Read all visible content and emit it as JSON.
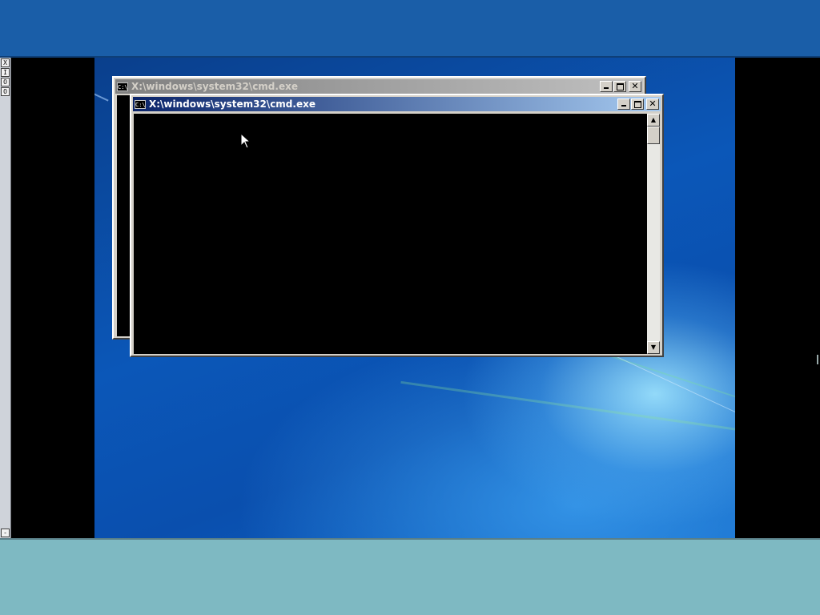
{
  "viewer_toolbar": {
    "buttons": [
      "X",
      "I",
      "O",
      "O"
    ],
    "bottom_button": "-"
  },
  "windows": [
    {
      "title": "X:\\windows\\system32\\cmd.exe",
      "state": "inactive",
      "icon": "cmd-icon",
      "icon_text": "C:\\"
    },
    {
      "title": "X:\\windows\\system32\\cmd.exe",
      "state": "active",
      "icon": "cmd-icon",
      "icon_text": "C:\\",
      "scroll_up": "▲",
      "scroll_down": "▼"
    }
  ],
  "colors": {
    "console_bg": "#000000",
    "active_title_start": "#0a246a",
    "active_title_end": "#a6caf0",
    "inactive_title": "#808080"
  }
}
